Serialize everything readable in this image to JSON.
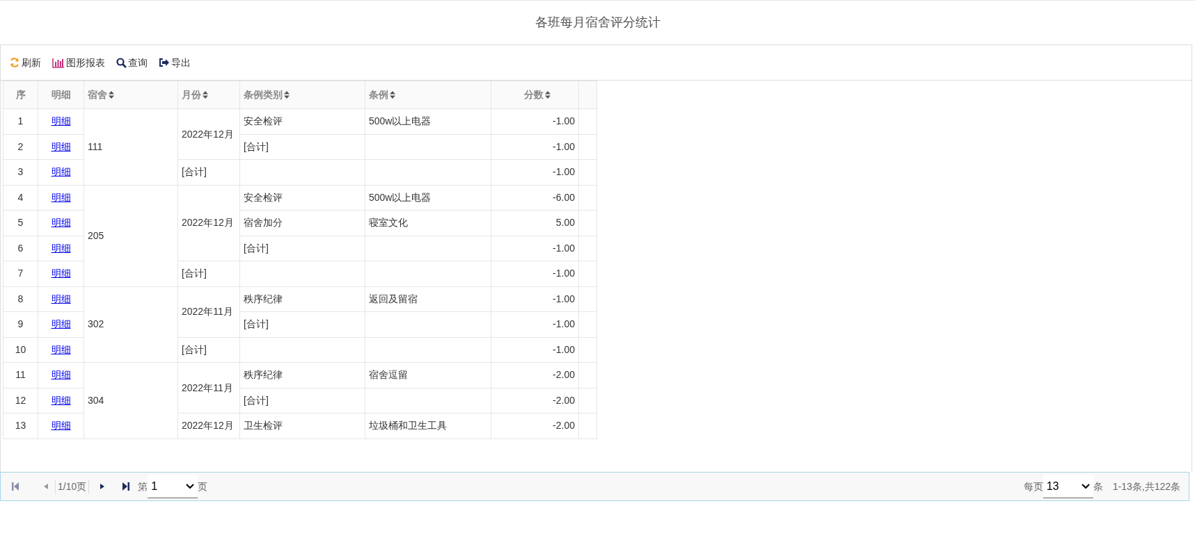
{
  "title": "各班每月宿舍评分统计",
  "toolbar": [
    {
      "kind": "refresh",
      "label": "刷新"
    },
    {
      "kind": "chart",
      "label": "图形报表"
    },
    {
      "kind": "search",
      "label": "查询"
    },
    {
      "kind": "export",
      "label": "导出"
    }
  ],
  "columns": [
    {
      "label": "序",
      "sortable": false
    },
    {
      "label": "明细",
      "sortable": false
    },
    {
      "label": "宿舍",
      "sortable": true
    },
    {
      "label": "月份",
      "sortable": true
    },
    {
      "label": "条例类别",
      "sortable": true
    },
    {
      "label": "条例",
      "sortable": true
    },
    {
      "label": "分数",
      "sortable": true
    }
  ],
  "dorms": [
    {
      "name": "111",
      "months": [
        {
          "label": "2022年12月",
          "rows": [
            {
              "no": "1",
              "link": "明细",
              "category": "安全检评",
              "rule": "500w以上电器",
              "score": "-1.00"
            },
            {
              "no": "2",
              "link": "明细",
              "category": "[合计]",
              "score": "-1.00"
            }
          ]
        },
        {
          "label": "[合计]",
          "rows": [
            {
              "no": "3",
              "link": "明细",
              "score": "-1.00"
            }
          ]
        }
      ]
    },
    {
      "name": "205",
      "months": [
        {
          "label": "2022年12月",
          "rows": [
            {
              "no": "4",
              "link": "明细",
              "category": "安全检评",
              "rule": "500w以上电器",
              "score": "-6.00"
            },
            {
              "no": "5",
              "link": "明细",
              "category": "宿舍加分",
              "rule": "寝室文化",
              "score": "5.00"
            },
            {
              "no": "6",
              "link": "明细",
              "category": "[合计]",
              "score": "-1.00"
            }
          ]
        },
        {
          "label": "[合计]",
          "rows": [
            {
              "no": "7",
              "link": "明细",
              "score": "-1.00"
            }
          ]
        }
      ]
    },
    {
      "name": "302",
      "months": [
        {
          "label": "2022年11月",
          "rows": [
            {
              "no": "8",
              "link": "明细",
              "category": "秩序纪律",
              "rule": "返回及留宿",
              "score": "-1.00"
            },
            {
              "no": "9",
              "link": "明细",
              "category": "[合计]",
              "score": "-1.00"
            }
          ]
        },
        {
          "label": "[合计]",
          "rows": [
            {
              "no": "10",
              "link": "明细",
              "score": "-1.00"
            }
          ]
        }
      ]
    },
    {
      "name": "304",
      "months": [
        {
          "label": "2022年11月",
          "rows": [
            {
              "no": "11",
              "link": "明细",
              "category": "秩序纪律",
              "rule": "宿舍逗留",
              "score": "-2.00"
            },
            {
              "no": "12",
              "link": "明细",
              "category": "[合计]",
              "score": "-2.00"
            }
          ]
        },
        {
          "label": "2022年12月",
          "rows": [
            {
              "no": "13",
              "link": "明细",
              "category": "卫生检评",
              "rule": "垃圾桶和卫生工具",
              "score": "-2.00"
            }
          ]
        }
      ]
    }
  ],
  "pager": {
    "page_info": "1/10页",
    "page_prefix": "第",
    "page_value": "1",
    "page_suffix": "页",
    "per_page_prefix": "每页",
    "per_page_value": "13",
    "per_page_suffix": "条",
    "summary": "1-13条,共122条"
  }
}
